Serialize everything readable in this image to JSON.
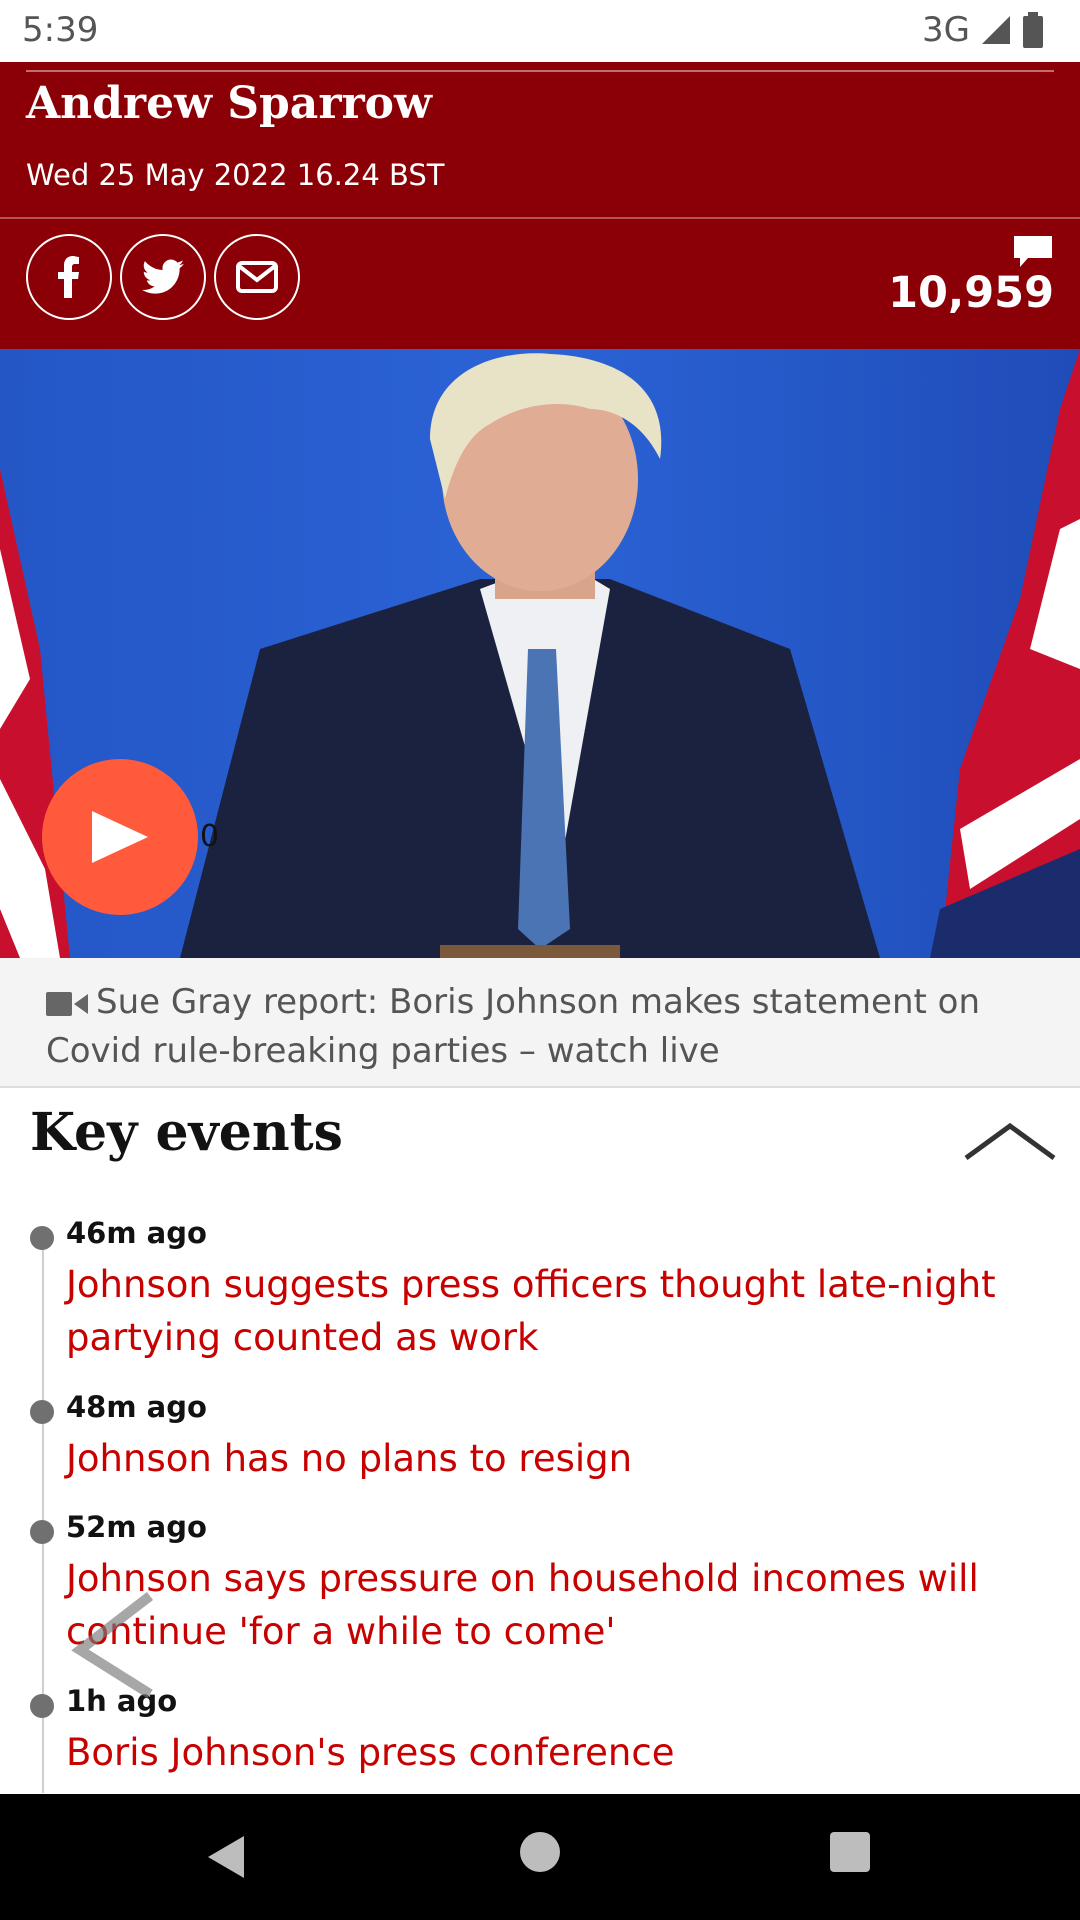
{
  "status_bar": {
    "time": "5:39",
    "network": "3G",
    "icons": [
      "signal-icon",
      "battery-icon"
    ]
  },
  "header": {
    "author": "Andrew Sparrow",
    "dateline": "Wed 25 May 2022 16.24 BST",
    "share_icons": [
      "facebook-icon",
      "twitter-icon",
      "email-icon"
    ],
    "comment_count": "10,959",
    "background_color": "#8b0006"
  },
  "video": {
    "duration_fragment": "0",
    "caption": "Sue Gray report: Boris Johnson makes statement on Covid rule-breaking parties – watch live"
  },
  "key_events": {
    "title": "Key events",
    "items": [
      {
        "time": "46m ago",
        "headline": "Johnson suggests press officers thought late-night partying counted as work"
      },
      {
        "time": "48m ago",
        "headline": "Johnson has no plans to resign"
      },
      {
        "time": "52m ago",
        "headline": "Johnson says pressure on household incomes will continue 'for a while to come'"
      },
      {
        "time": "1h ago",
        "headline": "Boris Johnson's press conference"
      }
    ]
  },
  "colors": {
    "accent": "#c70000",
    "play_button": "#ff5a3c"
  }
}
